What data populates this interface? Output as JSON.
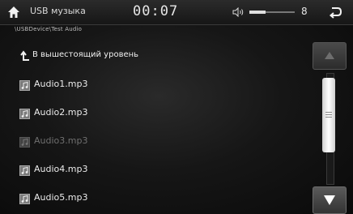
{
  "header": {
    "source_title": "USB музыка",
    "path": "\\USBDevice\\Test Audio",
    "time": "00:07",
    "volume_value": "8",
    "volume_level": 0.36
  },
  "list": {
    "up_label": "В вышестоящий уровень",
    "items": [
      {
        "label": "Audio1.mp3",
        "state": "normal"
      },
      {
        "label": "Audio2.mp3",
        "state": "normal"
      },
      {
        "label": "Audio3.mp3",
        "state": "dimmed"
      },
      {
        "label": "Audio4.mp3",
        "state": "normal"
      },
      {
        "label": "Audio5.mp3",
        "state": "normal"
      }
    ]
  },
  "scrollbar": {
    "thumb_position": 0.0,
    "thumb_fraction": 0.68
  },
  "icons": {
    "home": "home-icon",
    "volume": "speaker-icon",
    "back": "back-return-icon",
    "up": "up-level-arrow-icon",
    "file": "audio-file-icon",
    "scroll_up": "triangle-up-icon",
    "scroll_down": "triangle-down-icon"
  }
}
